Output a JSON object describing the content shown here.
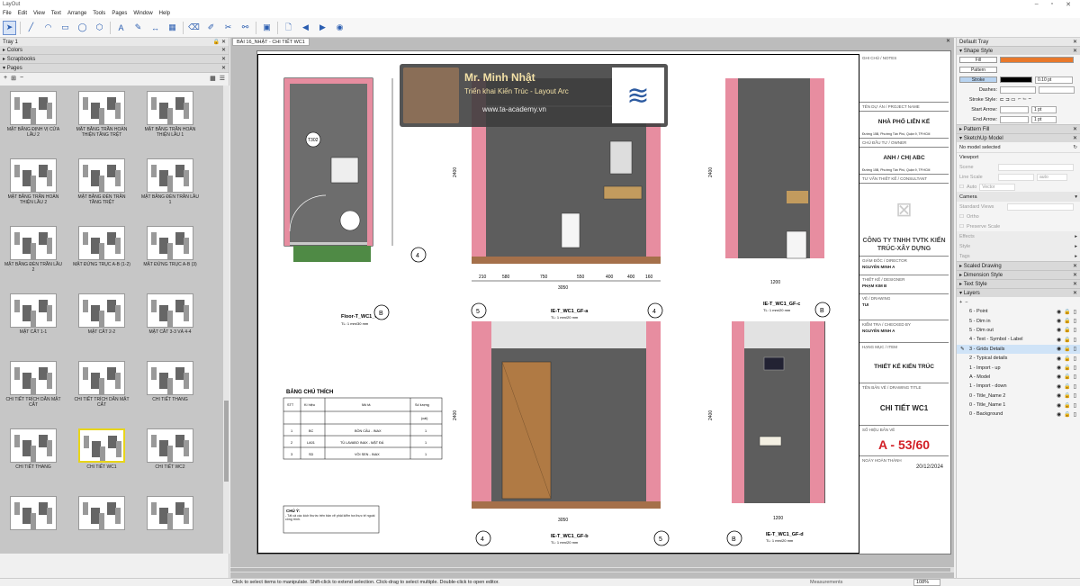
{
  "app": {
    "title": "LayOut",
    "window_controls": [
      "–",
      "▫",
      "✕"
    ]
  },
  "menu": [
    "File",
    "Edit",
    "View",
    "Text",
    "Arrange",
    "Tools",
    "Pages",
    "Window",
    "Help"
  ],
  "left_tray": {
    "title": "Tray 1",
    "pin": "🔒 ✕",
    "panels": [
      {
        "label": "Colors"
      },
      {
        "label": "Scrapbooks"
      },
      {
        "label": "Pages"
      }
    ],
    "pages_tools": {
      "add": "+",
      "dup": "⊞",
      "remove": "−"
    },
    "pages": [
      {
        "label": "MẶT BẰNG ĐỊNH VỊ CỬA LẦU 2"
      },
      {
        "label": "MẶT BẰNG TRẦN HOÀN THIỆN TẦNG TRỆT"
      },
      {
        "label": "MẶT BẰNG TRẦN HOÀN THIỆN LẦU 1"
      },
      {
        "label": "MẶT BẰNG TRẦN HOÀN THIỆN LẦU 2"
      },
      {
        "label": "MẶT BẰNG ĐÈN TRẦN TẦNG TRỆT"
      },
      {
        "label": "MẶT BẰNG ĐÈN TRẦN LẦU 1"
      },
      {
        "label": "MẶT BẰNG ĐÈN TRẦN LẦU 2"
      },
      {
        "label": "MẶT ĐỨNG TRỤC A-B (1-2)"
      },
      {
        "label": "MẶT ĐỨNG TRỤC A-B (3)"
      },
      {
        "label": "MẶT CẮT 1-1"
      },
      {
        "label": "MẶT CẮT 2-2"
      },
      {
        "label": "MẶT CẮT 3-3 VÀ 4-4"
      },
      {
        "label": "CHI TIẾT TRÍCH DẪN MẶT CẮT"
      },
      {
        "label": "CHI TIẾT TRÍCH DẪN MẶT CẮT"
      },
      {
        "label": "CHI TIẾT THANG"
      },
      {
        "label": "CHI TIẾT THANG"
      },
      {
        "label": "CHI TIẾT WC1",
        "selected": true
      },
      {
        "label": "CHI TIẾT WC2"
      },
      {
        "label": ""
      },
      {
        "label": ""
      },
      {
        "label": ""
      }
    ]
  },
  "document": {
    "tab": "BÀI 16_NHẬT - CHI TIẾT WC1",
    "close": "✕",
    "watermark": {
      "name": "Mr. Minh Nhật",
      "subtitle": "Triển khai Kiến Trúc - Layout Arc",
      "website": "www.ta-academy.vn"
    },
    "views": [
      {
        "title": "Floor-T_WC1_GF",
        "scale": "TL: 1 mm/30 mm",
        "grid": "B"
      },
      {
        "title": "IE-T_WC1_GF-a",
        "scale": "TL: 1 mm/20 mm",
        "grids": [
          "5",
          "4"
        ]
      },
      {
        "title": "IE-T_WC1_GF-c",
        "scale": "TL: 1 mm/20 mm",
        "grid": "B"
      },
      {
        "title": "IE-T_WC1_GF-b",
        "scale": "TL: 1 mm/20 mm",
        "grids": [
          "4",
          "5"
        ]
      },
      {
        "title": "IE-T_WC1_GF-d",
        "scale": "TL: 1 mm/20 mm",
        "grid": "B"
      }
    ],
    "dims_a": [
      "210",
      "580",
      "750",
      "550",
      "400",
      "400",
      "160"
    ],
    "dims_a_total": "3050",
    "dims_floor": [
      "200",
      "530",
      "750",
      "550",
      "400",
      "410"
    ],
    "dims_floor_total": "3050",
    "dim_c": "1200",
    "dim_b_total": "3050",
    "dim_d": "1200",
    "dim_height": "2400",
    "legend": {
      "title": "BẢNG CHÚ THÍCH",
      "headers": [
        "STT",
        "Kí hiệu",
        "Mô tả",
        "Số lượng"
      ],
      "sub": "(cái)",
      "rows": [
        [
          "1",
          "BC",
          "BỒN CẦU - INAX",
          "1"
        ],
        [
          "2",
          "LA01",
          "TỦ LAVABO INAX - MẶT ĐÁ",
          "1"
        ],
        [
          "3",
          "SD",
          "VÒI SEN - INAX",
          "1"
        ]
      ]
    },
    "note": {
      "title": "CHÚ Ý:",
      "text": "- Tất cả các kích thước trên bản vẽ phải kiểm tra thực tế ngoài công trình."
    },
    "title_block": {
      "notes_label": "GHI CHÚ / NOTES",
      "project_label": "TÊN DỰ ÁN / PROJECT NAME",
      "project": "NHÀ PHỐ LIÊN KẾ",
      "address": "Đường 15B, Phường Tân Phú, Quận 9, TP.HCM",
      "owner_label": "CHỦ ĐẦU TƯ / OWNER",
      "owner": "ANH / CHỊ ABC",
      "consultant_label": "TƯ VẤN THIẾT KẾ / CONSULTANT",
      "company": "CÔNG TY TNHH TVTK KIẾN TRÚC-XÂY DỰNG",
      "director_label": "GIÁM ĐỐC / DIRECTOR",
      "director": "NGUYỄN MINH A",
      "designer_label": "THIẾT KẾ / DESIGNER",
      "designer": "PHẠM KIM B",
      "drawing_label": "VẼ / DRAWING",
      "drawer": "TUI",
      "checked_label": "KIỂM TRA / CHECKED BY",
      "checker": "NGUYỄN MINH A",
      "item_label": "HẠNG MỤC / ITEM",
      "item": "THIẾT KẾ KIẾN TRÚC",
      "dtitle_label": "TÊN BẢN VẼ / DRAWING TITLE",
      "dtitle": "CHI TIẾT WC1",
      "sheet_label": "SỐ HIỆU BẢN VẼ",
      "sheet": "A - 53/60",
      "date_label": "NGÀY HOÀN THÀNH",
      "date": "20/12/2024"
    }
  },
  "status": {
    "hint": "Click to select items to manipulate. Shift-click to extend selection. Click-drag to select multiple. Double-click to open editor.",
    "measurements": "Measurements",
    "zoom": "108%"
  },
  "right_tray": {
    "title": "Default Tray",
    "shape_style": "Shape Style",
    "fill": "Fill",
    "pattern": "Pattern",
    "stroke": "Stroke",
    "stroke_value": "0.10 pt",
    "dashes": "Dashes:",
    "stroke_style": "Stroke Style:",
    "start_arrow": "Start Arrow:",
    "end_arrow": "End Arrow:",
    "arrow_value": "1 pt",
    "pattern_fill": "Pattern Fill",
    "sketchup_model": "SketchUp Model",
    "no_model": "No model selected",
    "viewport": "Viewport",
    "scene": "Scene",
    "line_scale": "Line Scale",
    "auto": "auto",
    "auto2": "Auto",
    "vector": "Vector",
    "camera": "Camera",
    "standard_views": "Standard Views",
    "ortho": "Ortho",
    "preserve_scale": "Preserve Scale",
    "effects": "Effects",
    "style": "Style",
    "tags": "Tags",
    "scaled_drawing": "Scaled Drawing",
    "dimension_style": "Dimension Style",
    "text_style": "Text Style",
    "layers": "Layers",
    "layer_list": [
      {
        "name": "6 - Point"
      },
      {
        "name": "5 - Dim in"
      },
      {
        "name": "5 - Dim out"
      },
      {
        "name": "4 - Text - Symbol - Label"
      },
      {
        "name": "3 - Grids Details",
        "selected": true
      },
      {
        "name": "2 - Typical details"
      },
      {
        "name": "1 - Import - up"
      },
      {
        "name": "A - Model"
      },
      {
        "name": "1 - Import - down"
      },
      {
        "name": "0 - Title_Name 2"
      },
      {
        "name": "0 - Title_Name 1"
      },
      {
        "name": "0 - Background"
      }
    ],
    "colors": {
      "fill": "#e8782b",
      "stroke": "#000000",
      "selected": "#cfe3f7"
    }
  }
}
